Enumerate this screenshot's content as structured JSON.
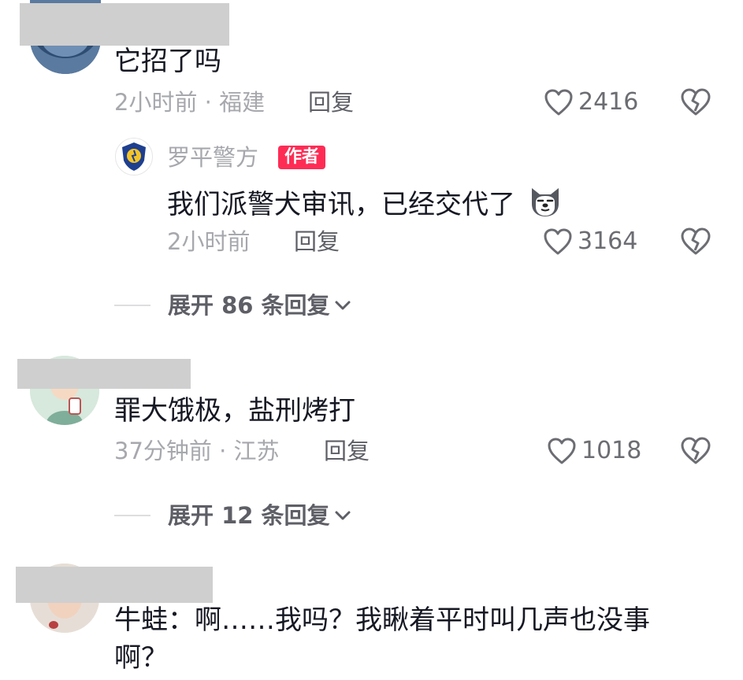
{
  "comments": [
    {
      "text": "它招了吗",
      "meta": "2小时前 · 福建",
      "reply_label": "回复",
      "likes": "2416",
      "colors": {
        "avatar": "#3f5f85"
      },
      "icons": {
        "like": "heart-outline-icon",
        "dislike": "broken-heart-icon"
      },
      "sub_reply": {
        "author": "罗平警方",
        "author_badge": "作者",
        "text": "我们派警犬审讯，已经交代了",
        "emoji": "dog-emoji-icon",
        "meta": "2小时前",
        "reply_label": "回复",
        "likes": "3164"
      },
      "expand_label": "展开 86 条回复"
    },
    {
      "text": "罪大饿极，盐刑烤打",
      "meta": "37分钟前 · 江苏",
      "reply_label": "回复",
      "likes": "1018",
      "colors": {
        "avatar": "#cfe3d5"
      },
      "expand_label": "展开 12 条回复"
    },
    {
      "text_line1": "牛蛙：啊……我吗？我瞅着平时叫几声也没事",
      "text_line2": "啊？",
      "colors": {
        "avatar": "#e0d8d0"
      }
    }
  ],
  "theme": {
    "accent": "#fe2c55",
    "meta_gray": "#a7a8ad",
    "text": "#161823"
  }
}
